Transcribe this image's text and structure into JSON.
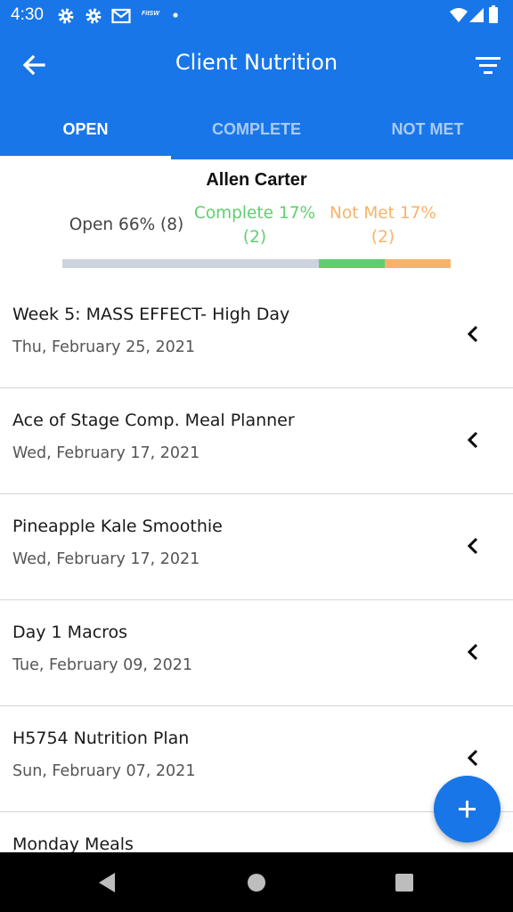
{
  "status_bar": {
    "time": "4:30",
    "small_label": "FitSW",
    "icons": [
      "gear-icon",
      "gear-icon",
      "gmail-icon",
      "fitsw-icon",
      "dot-icon",
      "wifi-icon",
      "signal-icon",
      "battery-icon"
    ]
  },
  "app_bar": {
    "title": "Client Nutrition",
    "back_icon": "arrow-back-icon",
    "filter_icon": "filter-icon"
  },
  "tabs": [
    {
      "label": "OPEN",
      "active": true
    },
    {
      "label": "COMPLETE",
      "active": false
    },
    {
      "label": "NOT MET",
      "active": false
    }
  ],
  "summary": {
    "client_name": "Allen Carter",
    "open_label": "Open 66% (8)",
    "complete_label": "Complete 17%",
    "complete_count": "(2)",
    "not_met_label": "Not Met 17%",
    "not_met_count": "(2)",
    "progress": {
      "open": 0.66,
      "complete": 0.17,
      "not_met": 0.17
    },
    "colors": {
      "open": "#cdd3de",
      "complete": "#5fcf6e",
      "not_met": "#f6b46a"
    }
  },
  "plans": [
    {
      "title": "Week 5: MASS EFFECT- High Day",
      "date": "Thu, February 25, 2021"
    },
    {
      "title": "Ace of Stage Comp. Meal Planner",
      "date": "Wed, February 17, 2021"
    },
    {
      "title": "Pineapple Kale Smoothie",
      "date": "Wed, February 17, 2021"
    },
    {
      "title": "Day 1 Macros",
      "date": "Tue, February 09, 2021"
    },
    {
      "title": "H5754 Nutrition Plan",
      "date": "Sun, February 07, 2021"
    },
    {
      "title": "Monday Meals",
      "date": ""
    }
  ],
  "fab": {
    "icon": "plus-icon"
  },
  "nav_bar": {
    "icons": [
      "nav-back-icon",
      "nav-home-icon",
      "nav-recents-icon"
    ]
  },
  "colors": {
    "primary": "#1976e8",
    "tab_inactive": "rgba(255,255,255,0.62)"
  }
}
